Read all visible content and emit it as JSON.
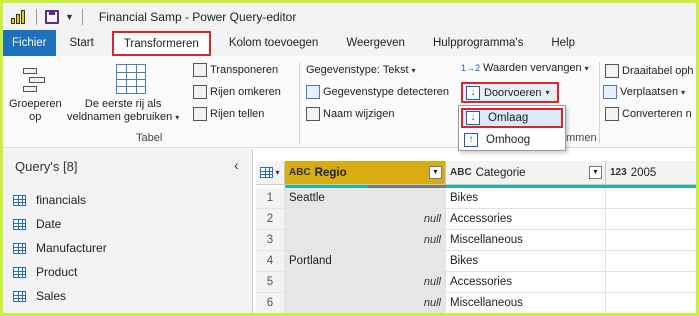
{
  "window": {
    "title": "Financial Samp - Power Query-editor"
  },
  "tabs": [
    {
      "label": "Fichier"
    },
    {
      "label": "Start"
    },
    {
      "label": "Transformeren"
    },
    {
      "label": "Kolom toevoegen"
    },
    {
      "label": "Weergeven"
    },
    {
      "label": "Hulpprogramma's"
    },
    {
      "label": "Help"
    }
  ],
  "ribbon": {
    "group_by": "Groeperen op",
    "group_by_lines": [
      "Groeperen",
      "op"
    ],
    "first_row_lines": [
      "De eerste rij als",
      "veldnamen gebruiken"
    ],
    "transpose": "Transponeren",
    "reverse_rows": "Rijen omkeren",
    "count_rows": "Rijen tellen",
    "table_group_label": "Tabel",
    "data_type": "Gegevenstype: Tekst",
    "detect_data_type": "Gegevenstype detecteren",
    "rename": "Naam wijzigen",
    "replace_values": "Waarden vervangen",
    "fill_down": "Doorvoeren",
    "pivot": "Draaitabel oph",
    "move": "Verplaatsen",
    "convert": "Converteren n",
    "any_column_group_label_partial": "mmen"
  },
  "dropdown": {
    "items": [
      {
        "label": "Omlaag"
      },
      {
        "label": "Omhoog"
      }
    ]
  },
  "queries": {
    "title": "Query's [8]",
    "items": [
      "financials",
      "Date",
      "Manufacturer",
      "Product",
      "Sales"
    ]
  },
  "grid": {
    "columns": [
      {
        "type_glyph": "ABC",
        "name": "Regio"
      },
      {
        "type_glyph": "ABC",
        "name": "Categorie"
      },
      {
        "type_glyph": "123",
        "name": "2005"
      }
    ],
    "rows": [
      {
        "num": "1",
        "regio": "Seattle",
        "categorie": "Bikes"
      },
      {
        "num": "2",
        "regio": "null",
        "categorie": "Accessories"
      },
      {
        "num": "3",
        "regio": "null",
        "categorie": "Miscellaneous"
      },
      {
        "num": "4",
        "regio": "Portland",
        "categorie": "Bikes"
      },
      {
        "num": "5",
        "regio": "null",
        "categorie": "Accessories"
      },
      {
        "num": "6",
        "regio": "null",
        "categorie": "Miscellaneous"
      }
    ]
  },
  "colors": {
    "file_tab": "#1f6fbf",
    "highlight_border": "#d9262e",
    "selected_column": "#d8ac12",
    "quality_bar": "#1fb5a8"
  }
}
